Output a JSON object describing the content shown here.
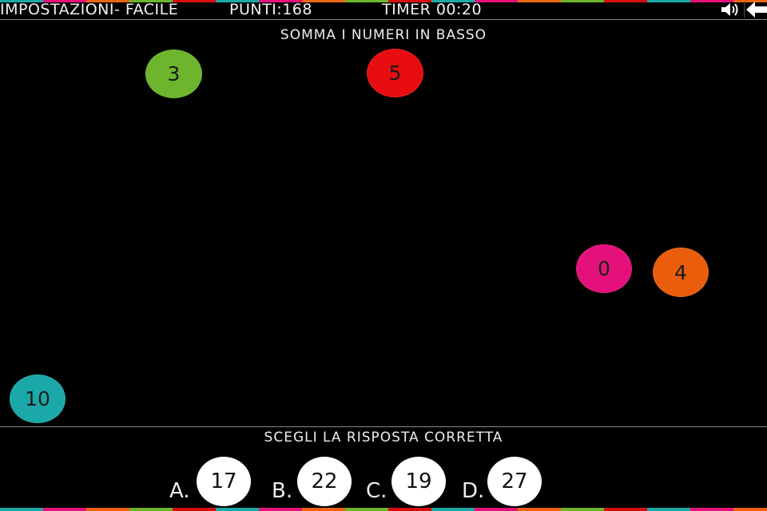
{
  "stripe_colors": [
    "#1aa9a8",
    "#e5117a",
    "#eb6414",
    "#6cb52d",
    "#d90d10"
  ],
  "header": {
    "settings_label": "IMPOSTAZIONI- FACILE",
    "score_label": "PUNTI:168",
    "timer_label": "TIMER 00:20",
    "sound_icon": "speaker-icon",
    "back_icon": "arrow-left-icon"
  },
  "game": {
    "instruction": "SOMMA I NUMERI IN BASSO",
    "balls": [
      {
        "value": "3",
        "color": "#6cb52d"
      },
      {
        "value": "5",
        "color": "#e80d10"
      },
      {
        "value": "0",
        "color": "#e5117a"
      },
      {
        "value": "4",
        "color": "#e95d0c"
      },
      {
        "value": "10",
        "color": "#1aa9a8"
      }
    ]
  },
  "answers": {
    "prompt": "SCEGLI LA RISPOSTA CORRETTA",
    "options": [
      {
        "letter": "A.",
        "value": "17"
      },
      {
        "letter": "B.",
        "value": "22"
      },
      {
        "letter": "C.",
        "value": "19"
      },
      {
        "letter": "D.",
        "value": "27"
      }
    ]
  }
}
